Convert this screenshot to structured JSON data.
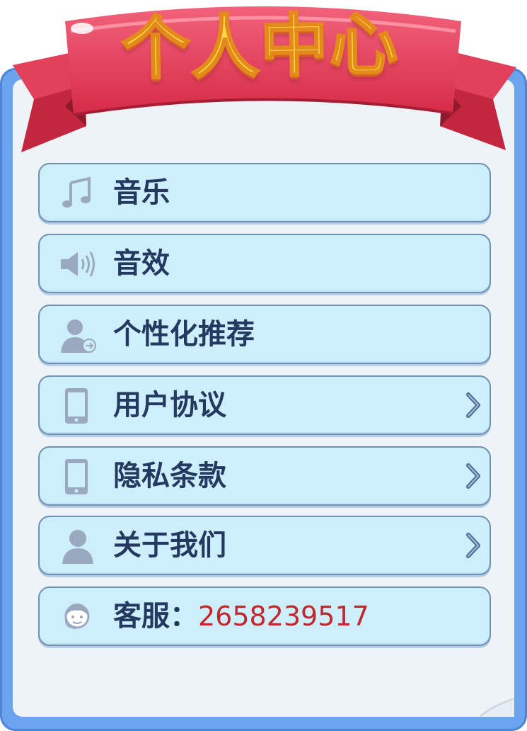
{
  "header": {
    "title": "个人中心"
  },
  "menu": [
    {
      "label": "音乐",
      "icon": "music-note-icon"
    },
    {
      "label": "音效",
      "icon": "speaker-icon"
    },
    {
      "label": "个性化推荐",
      "icon": "user-share-icon"
    },
    {
      "label": "用户协议",
      "icon": "tablet-icon"
    },
    {
      "label": "隐私条款",
      "icon": "tablet-icon"
    },
    {
      "label": "关于我们",
      "icon": "user-icon"
    }
  ],
  "service": {
    "label": "客服：",
    "phone": "2658239517",
    "icon": "customer-service-icon"
  },
  "colors": {
    "panel_border": "#6aa4ee",
    "item_bg": "#cdeefb",
    "text": "#24395f",
    "phone": "#c4262e",
    "ribbon": "#e23c57",
    "title": "#ffd84a"
  }
}
